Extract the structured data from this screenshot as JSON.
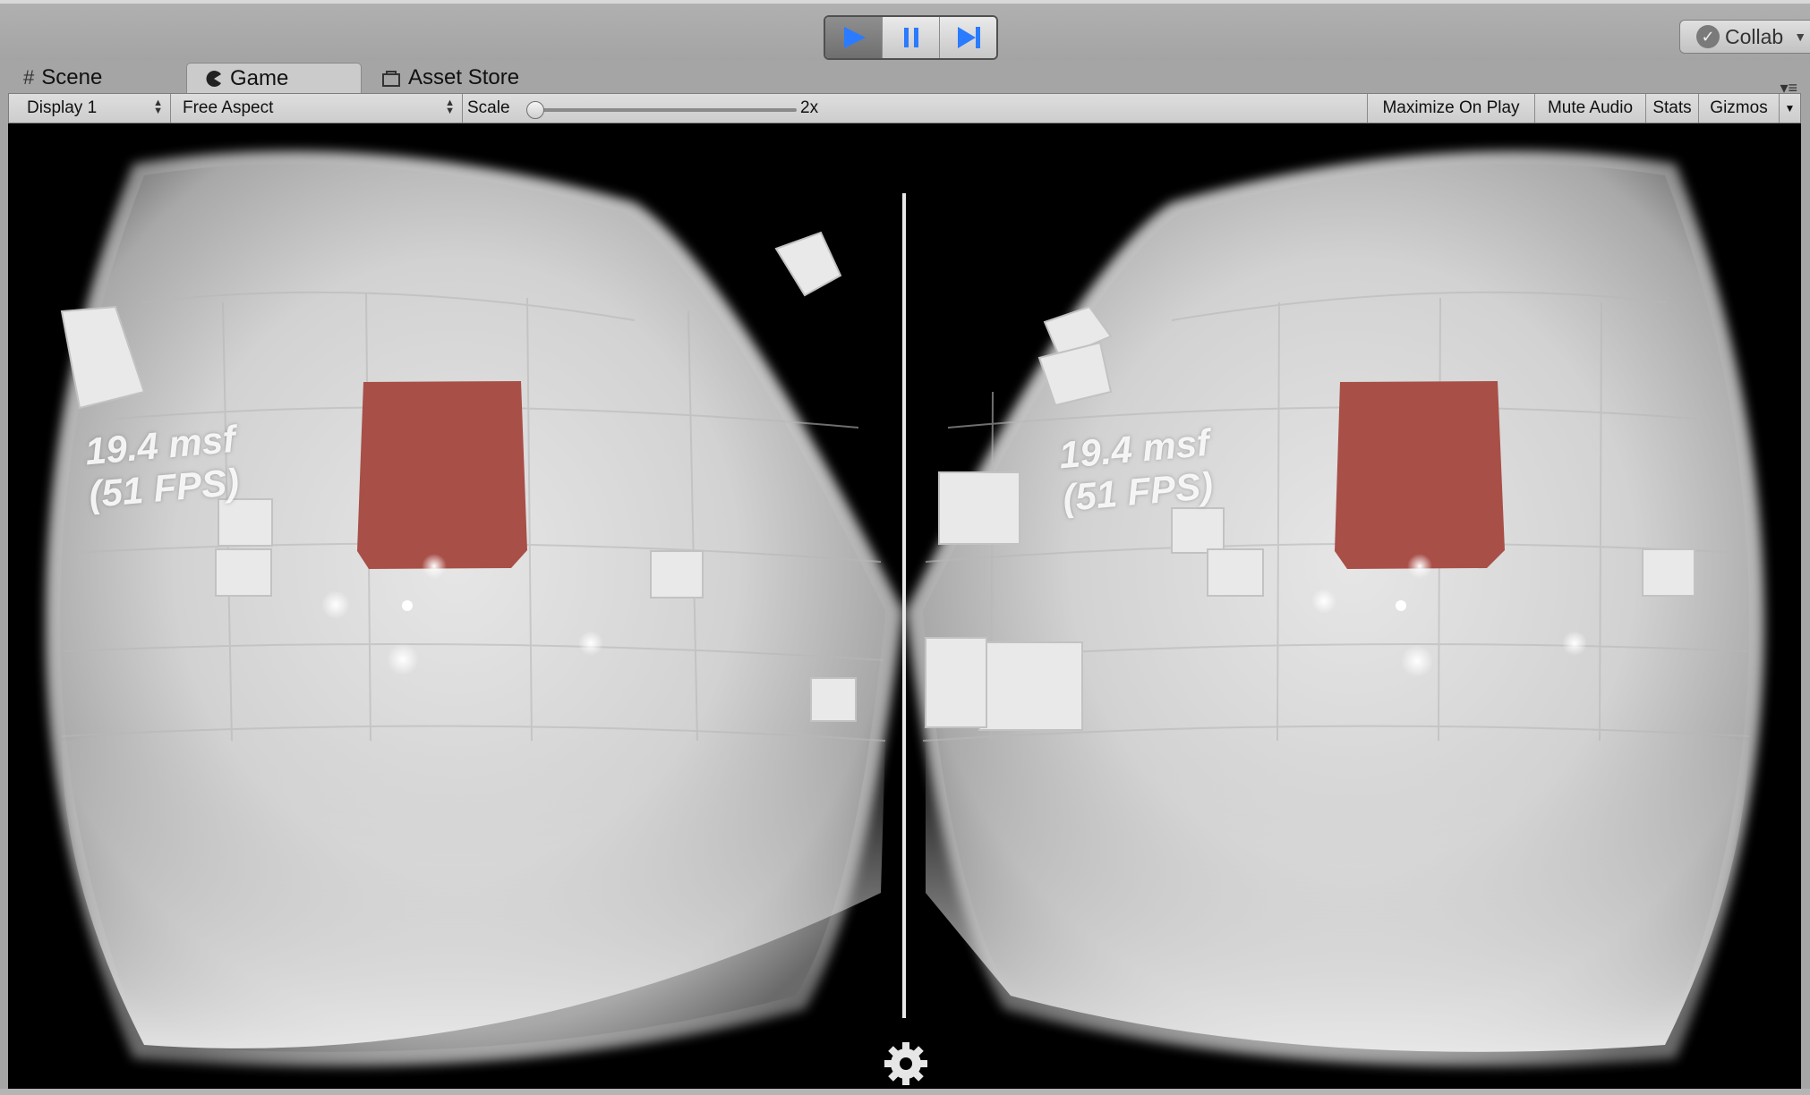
{
  "toolbar": {
    "play_icon": "play-icon",
    "pause_icon": "pause-icon",
    "step_icon": "step-icon",
    "collab_label": "Collab",
    "accent_color": "#2a7bff"
  },
  "tabs": [
    {
      "label": "Scene",
      "icon": "grid-icon"
    },
    {
      "label": "Game",
      "icon": "pacman-icon"
    },
    {
      "label": "Asset Store",
      "icon": "store-icon"
    }
  ],
  "gamebar": {
    "display": "Display 1",
    "aspect": "Free Aspect",
    "scale_label": "Scale",
    "scale_value": "2x",
    "maximize_on_play": "Maximize On Play",
    "mute_audio": "Mute Audio",
    "stats": "Stats",
    "gizmos": "Gizmos"
  },
  "viewport": {
    "left_eye_text_line1": "19.4 msf",
    "left_eye_text_line2": "(51 FPS)",
    "right_eye_text_line1": "19.4 msf",
    "right_eye_text_line2": "(51 FPS)",
    "cube_color": "#a84f48",
    "settings_icon": "gear-icon"
  }
}
